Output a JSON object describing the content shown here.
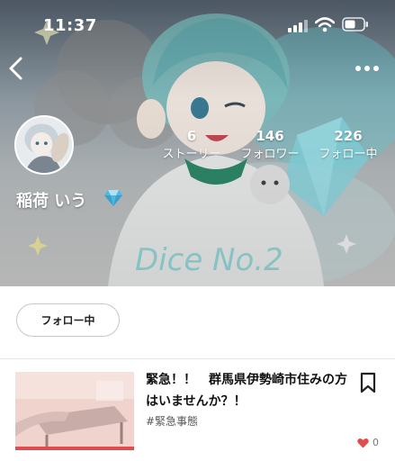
{
  "status_bar": {
    "time": "11:37"
  },
  "profile": {
    "name": "稲荷 いう",
    "stats": [
      {
        "value": "6",
        "label": "ストーリー"
      },
      {
        "value": "146",
        "label": "フォロワー"
      },
      {
        "value": "226",
        "label": "フォロー中"
      }
    ],
    "follow_label": "フォロー中"
  },
  "story": {
    "title": "緊急！！　群馬県伊勢崎市住みの方はいませんか？！",
    "tag": "#緊急事態",
    "likes": "0"
  },
  "colors": {
    "accent_red": "#e04b4b",
    "diamond": "#4fb7e0",
    "text_dark": "#111111"
  },
  "icons": [
    "signal-icon",
    "wifi-icon",
    "battery-icon",
    "back-chevron-icon",
    "more-dots-icon",
    "diamond-icon",
    "bookmark-icon",
    "heart-icon"
  ]
}
